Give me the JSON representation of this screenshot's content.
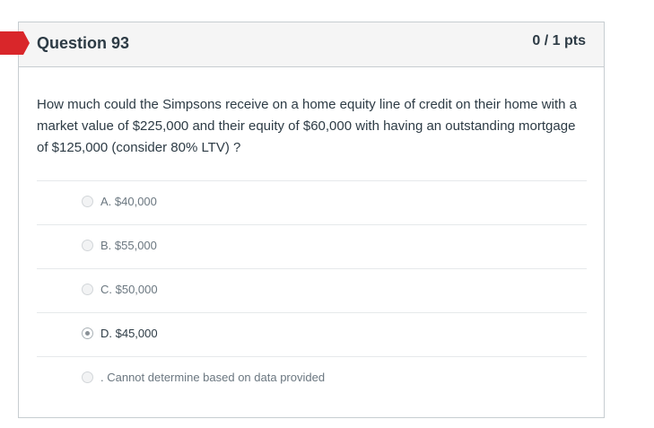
{
  "question": {
    "title": "Question 93",
    "points": "0 / 1 pts",
    "flag_color": "#d9262a",
    "text": "How much could the Simpsons receive on a home equity line of credit on their home with a market value of $225,000 and their equity of $60,000 with having an outstanding mortgage of $125,000 (consider 80% LTV) ?",
    "answers": [
      {
        "label": "A. $40,000",
        "selected": false
      },
      {
        "label": "B. $55,000",
        "selected": false
      },
      {
        "label": "C. $50,000",
        "selected": false
      },
      {
        "label": "D. $45,000",
        "selected": true
      },
      {
        "label": ". Cannot determine based on data provided",
        "selected": false
      }
    ]
  }
}
